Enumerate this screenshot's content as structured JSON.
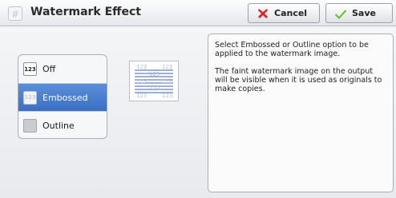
{
  "header": {
    "title": "Watermark Effect",
    "icon": "watermark-icon",
    "cancel_label": "Cancel",
    "save_label": "Save"
  },
  "options": [
    {
      "badge": "123",
      "label": "Off",
      "selected": false
    },
    {
      "badge": "123",
      "label": "Embossed",
      "selected": true
    },
    {
      "badge": "123",
      "label": "Outline",
      "selected": false
    }
  ],
  "preview": {
    "icon": "embossed-watermark-preview-icon"
  },
  "info": {
    "paragraph1": "Select Embossed or Outline option to be applied to the watermark image.",
    "paragraph2": "The faint watermark image on the output will be visible when it is used as originals to make copies."
  },
  "colors": {
    "selected": "#3f75c8",
    "cancel_icon": "#d9262b",
    "save_icon": "#6dbb2f"
  }
}
